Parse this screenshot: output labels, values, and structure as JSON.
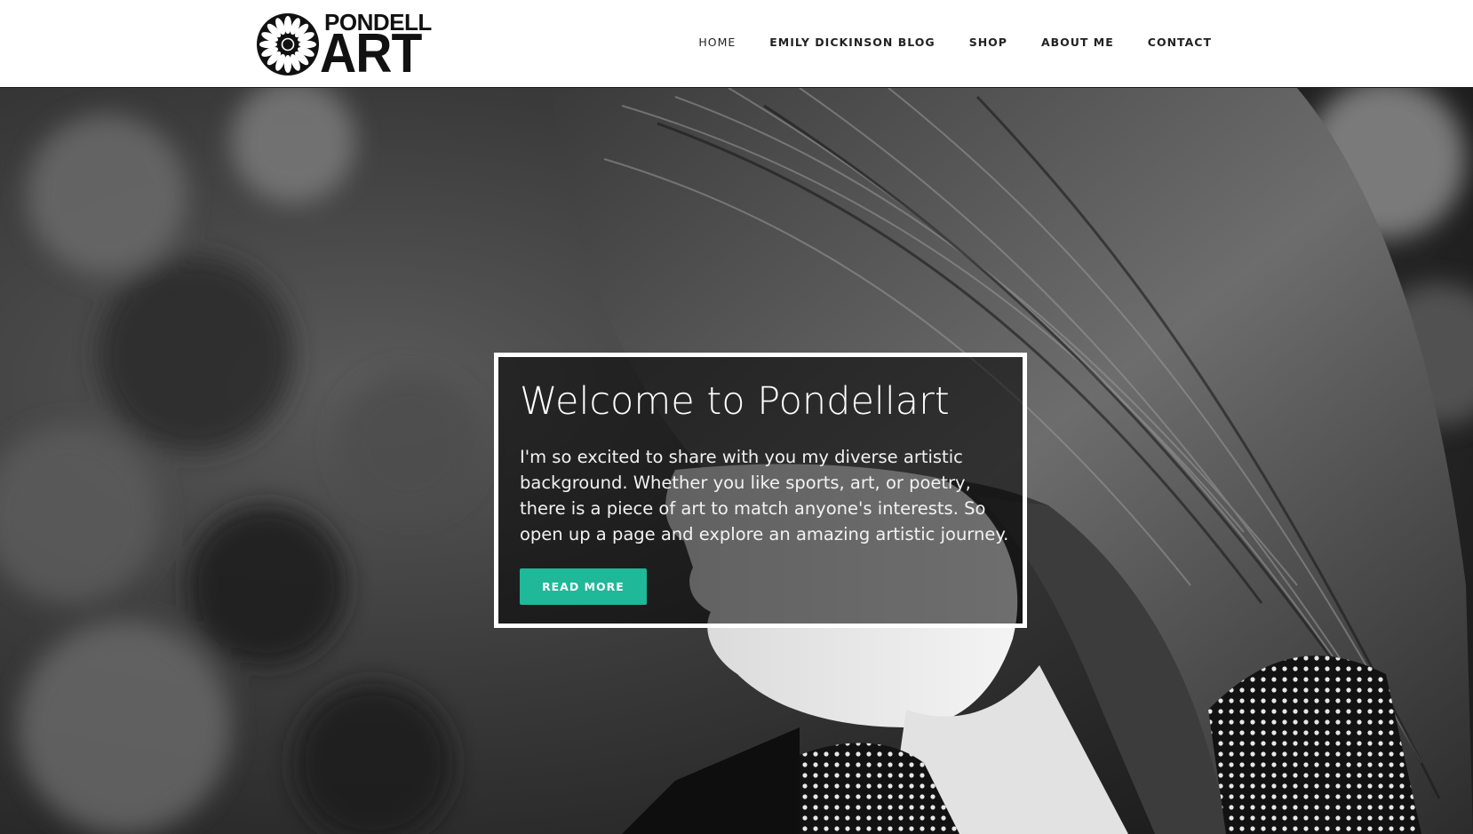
{
  "brand": {
    "logo_top": "PONDELL",
    "logo_bottom": "ART"
  },
  "nav": {
    "items": [
      {
        "label": "HOME"
      },
      {
        "label": "EMILY DICKINSON BLOG"
      },
      {
        "label": "SHOP"
      },
      {
        "label": "ABOUT ME"
      },
      {
        "label": "CONTACT"
      }
    ]
  },
  "hero": {
    "title": "Welcome to Pondellart",
    "text": "I'm so excited to share with you my diverse artistic background. Whether you like sports, art, or poetry, there is a piece of art to match anyone's interests. So open up a page and explore an amazing artistic journey.",
    "button_label": "READ MORE",
    "image_description_icon": "portrait-photo"
  },
  "colors": {
    "accent": "#1fb899",
    "header_bg": "#ffffff",
    "text_dark": "#222222"
  }
}
